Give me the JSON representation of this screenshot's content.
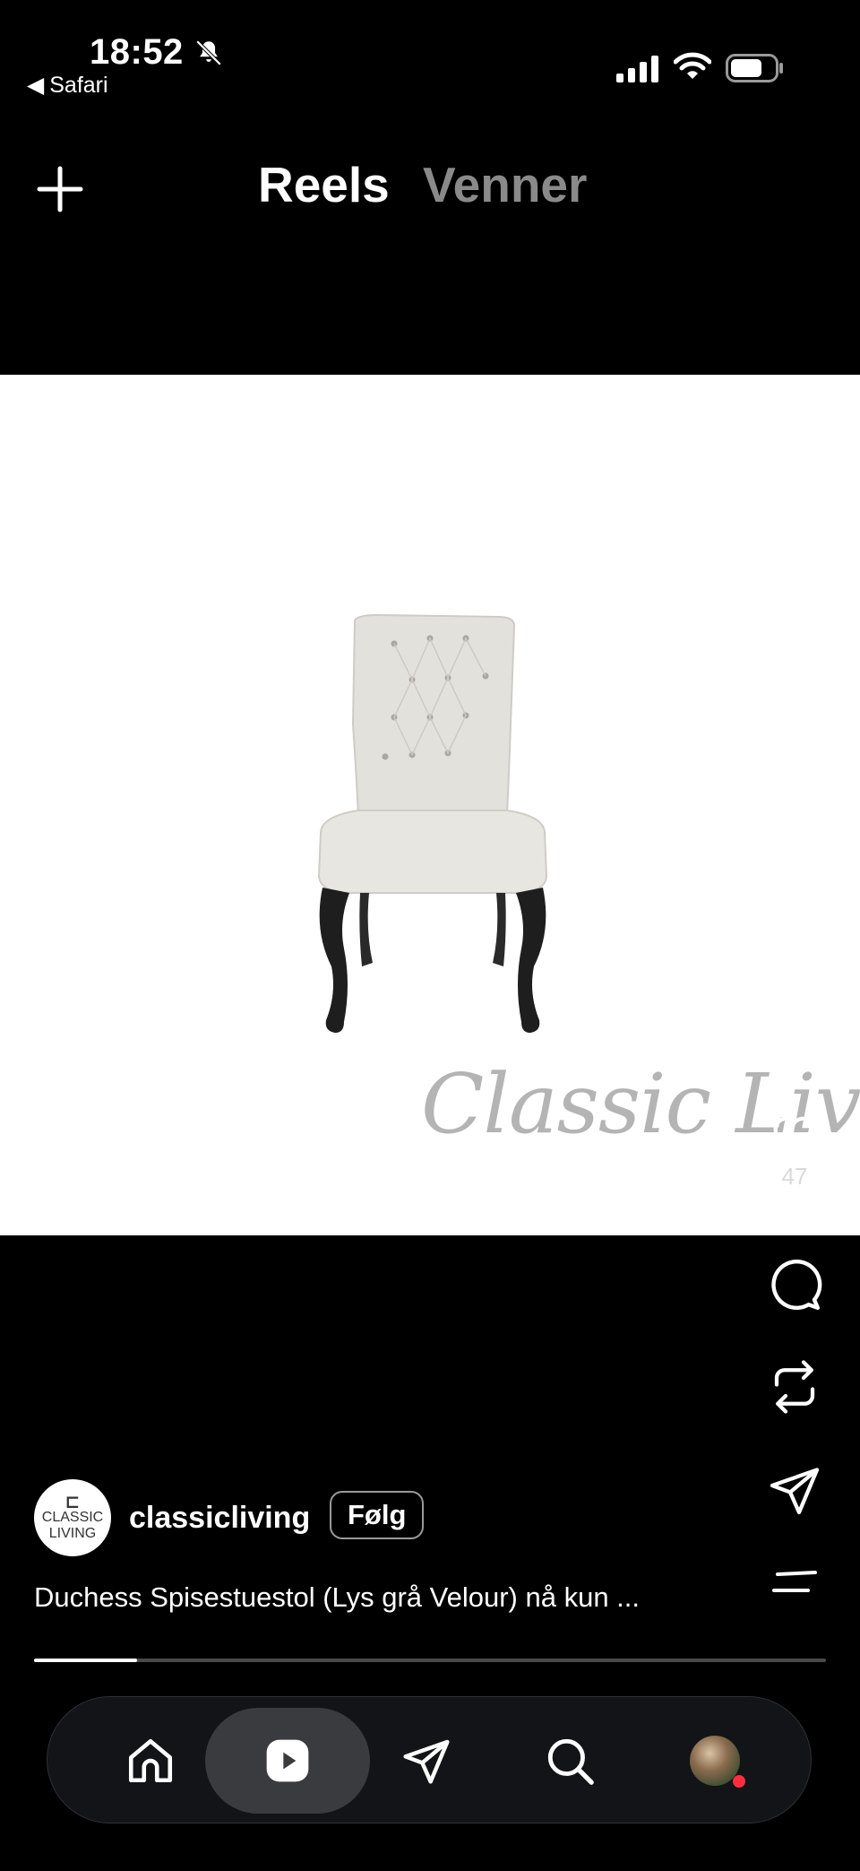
{
  "status_bar": {
    "time": "18:52",
    "back_app": "Safari"
  },
  "header": {
    "tabs": [
      {
        "label": "Reels",
        "active": true
      },
      {
        "label": "Venner",
        "active": false
      }
    ]
  },
  "media": {
    "watermark": "Classic Living"
  },
  "actions": {
    "like_count": "47"
  },
  "post": {
    "avatar_text_top": "CLASSIC",
    "avatar_text_bottom": "LIVING",
    "username": "classicliving",
    "follow_label": "Følg",
    "caption": "Duchess Spisestuestol (Lys grå Velour) nå kun ...",
    "progress_fraction": 0.13
  },
  "nav": {
    "items": [
      "home-icon",
      "reels-icon",
      "messages-icon",
      "search-icon",
      "profile"
    ],
    "active": "reels-icon"
  },
  "colors": {
    "background": "#000000",
    "inactive_tab": "#8a8a8a",
    "notification_dot": "#ff2d3d"
  }
}
